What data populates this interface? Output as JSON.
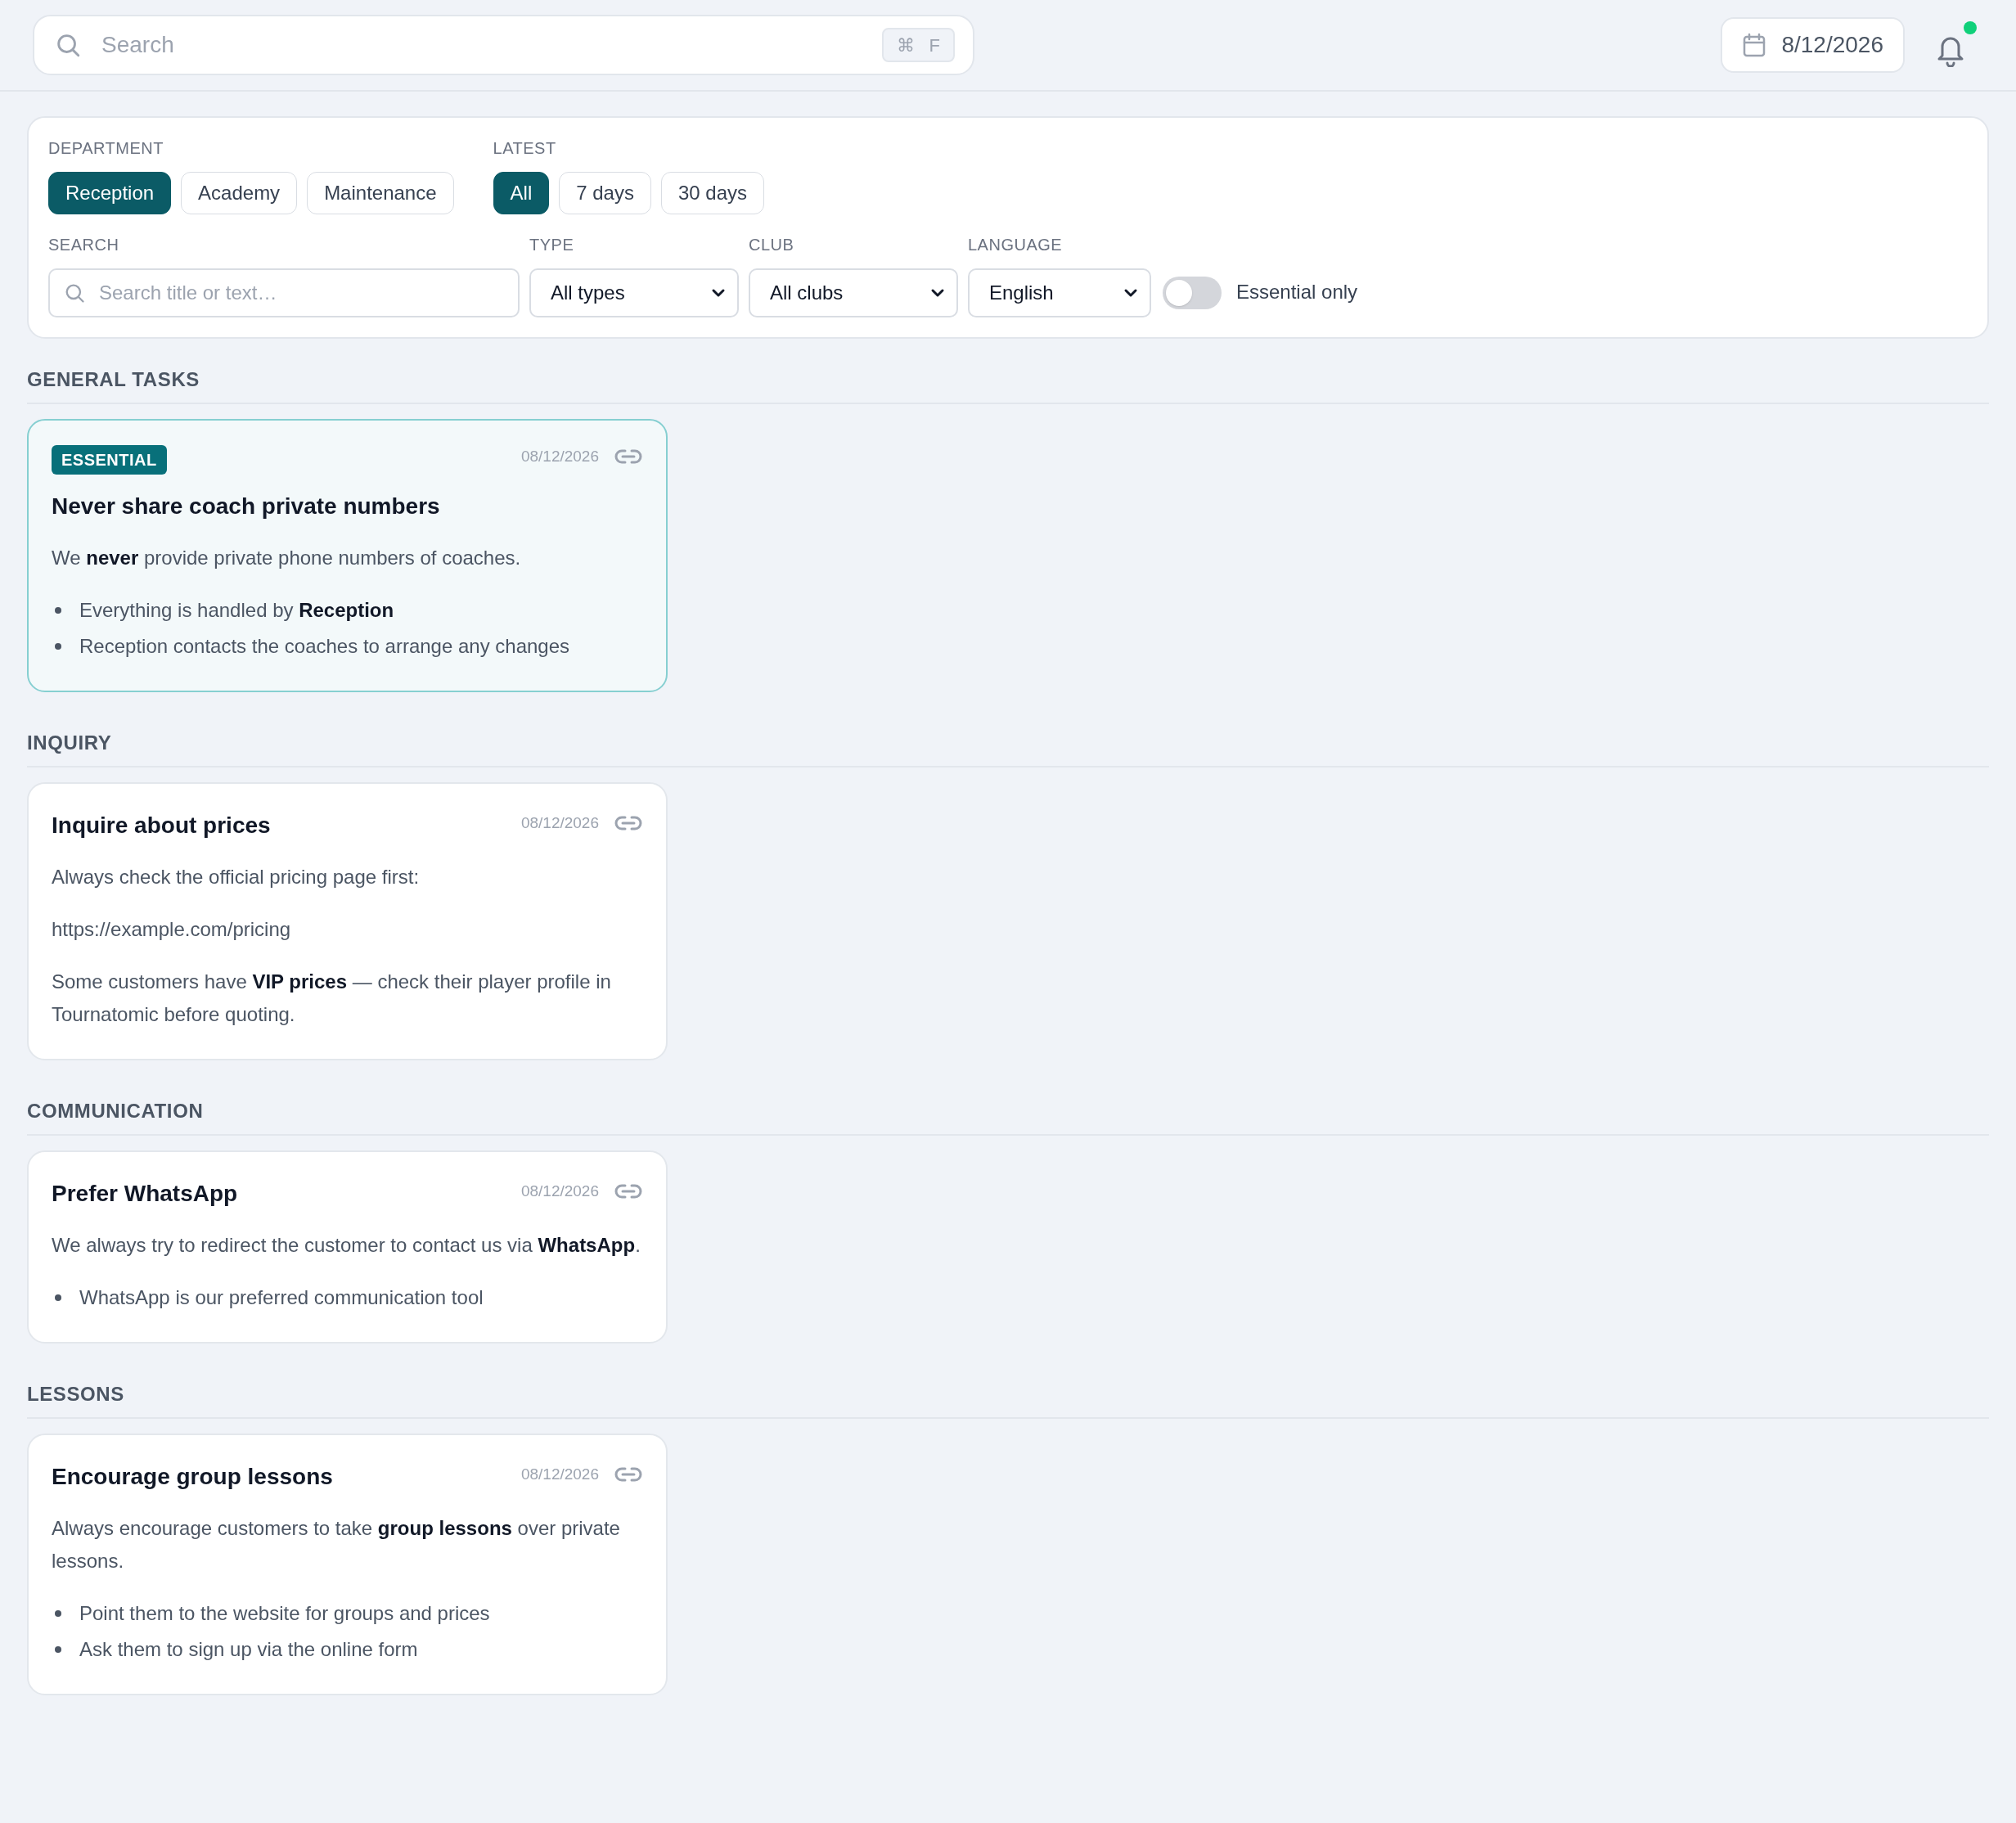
{
  "header": {
    "search": {
      "placeholder": "Search",
      "shortcut_keys": [
        "⌘",
        "F"
      ]
    },
    "date": "8/12/2026",
    "notifications": {
      "unread": true
    }
  },
  "filters": {
    "department": {
      "label": "DEPARTMENT",
      "options": [
        {
          "label": "Reception",
          "selected": true
        },
        {
          "label": "Academy",
          "selected": false
        },
        {
          "label": "Maintenance",
          "selected": false
        }
      ]
    },
    "latest": {
      "label": "LATEST",
      "options": [
        {
          "label": "All",
          "selected": true
        },
        {
          "label": "7 days",
          "selected": false
        },
        {
          "label": "30 days",
          "selected": false
        }
      ]
    },
    "search": {
      "label": "SEARCH",
      "placeholder": "Search title or text…"
    },
    "selects": [
      {
        "label": "TYPE",
        "value": "All types"
      },
      {
        "label": "CLUB",
        "value": "All clubs"
      },
      {
        "label": "LANGUAGE",
        "value": "English"
      }
    ],
    "essential_only": {
      "label": "Essential only",
      "on": false
    }
  },
  "sections": [
    {
      "title": "GENERAL TASKS",
      "cards": [
        {
          "essential": true,
          "badge": "ESSENTIAL",
          "title": "Never share coach private numbers",
          "date": "08/12/2026",
          "body": [
            {
              "kind": "paragraph",
              "text": "We **never** provide private phone numbers of coaches."
            },
            {
              "kind": "bullets",
              "items": [
                "Everything is handled by **Reception**",
                "Reception contacts the coaches to arrange any changes"
              ]
            }
          ]
        }
      ]
    },
    {
      "title": "INQUIRY",
      "cards": [
        {
          "essential": false,
          "title": "Inquire about prices",
          "date": "08/12/2026",
          "body": [
            {
              "kind": "paragraph",
              "text": "Always check the official pricing page first:"
            },
            {
              "kind": "paragraph",
              "text": "https://example.com/pricing"
            },
            {
              "kind": "paragraph",
              "text": "Some customers have **VIP prices** — check their player profile in Tournatomic before quoting."
            }
          ]
        }
      ]
    },
    {
      "title": "COMMUNICATION",
      "cards": [
        {
          "essential": false,
          "title": "Prefer WhatsApp",
          "date": "08/12/2026",
          "body": [
            {
              "kind": "paragraph",
              "text": "We always try to redirect the customer to contact us via **WhatsApp**."
            },
            {
              "kind": "bullets",
              "items": [
                "WhatsApp is our preferred communication tool"
              ]
            }
          ]
        }
      ]
    },
    {
      "title": "LESSONS",
      "cards": [
        {
          "essential": false,
          "title": "Encourage group lessons",
          "date": "08/12/2026",
          "body": [
            {
              "kind": "paragraph",
              "text": "Always encourage customers to take **group lessons** over private lessons."
            },
            {
              "kind": "bullets",
              "items": [
                "Point them to the website for groups and prices",
                "Ask them to sign up via the online form"
              ]
            }
          ]
        }
      ]
    }
  ]
}
